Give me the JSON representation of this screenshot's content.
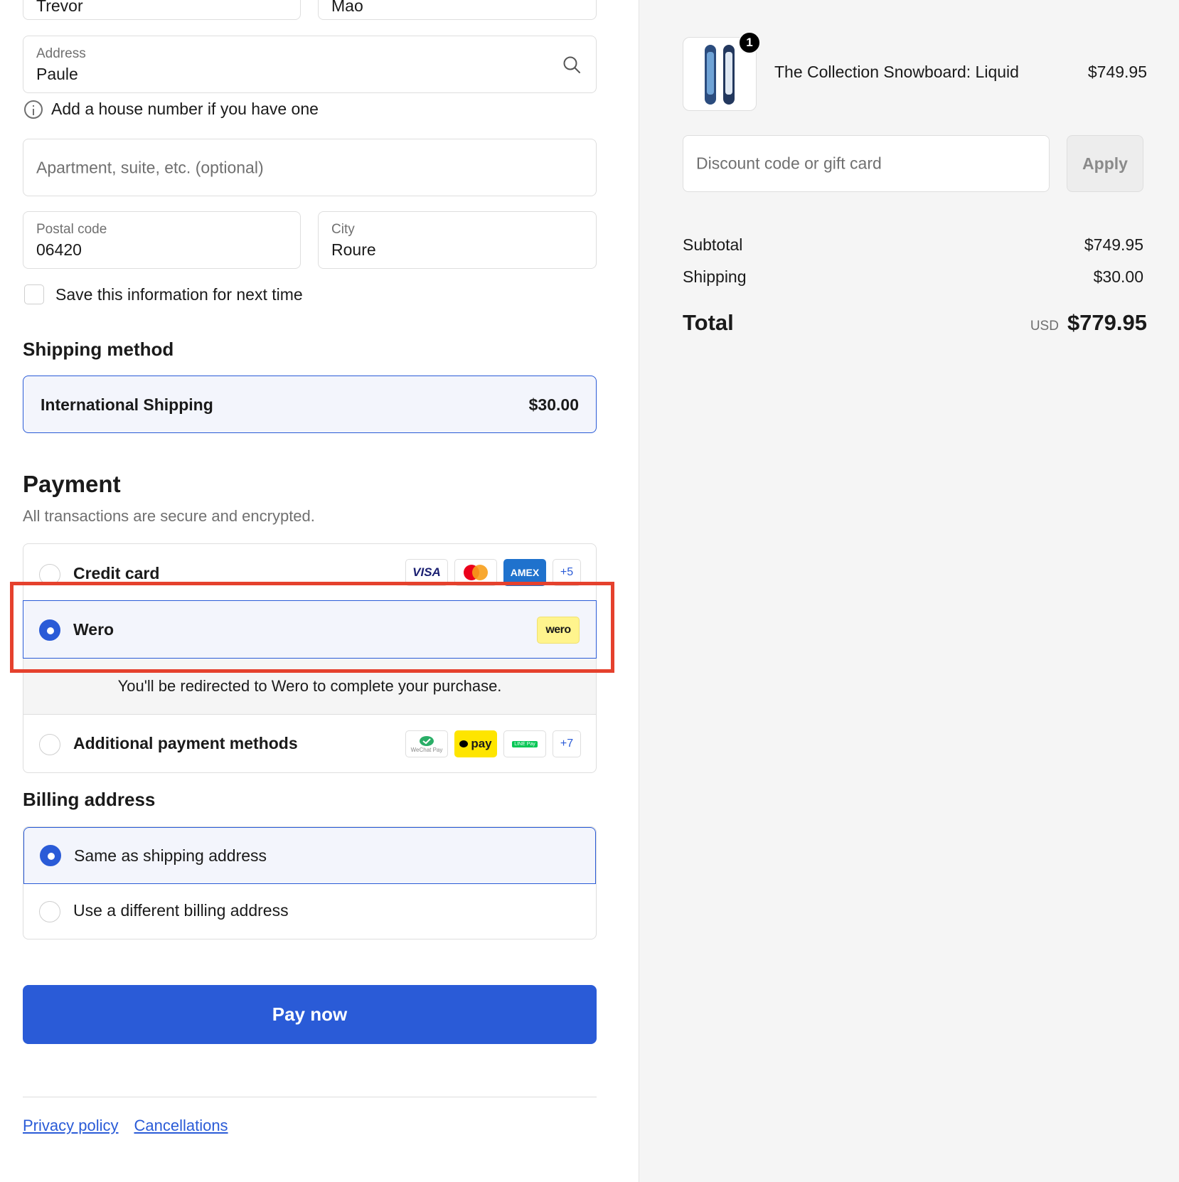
{
  "form": {
    "first_name_value": "Trevor",
    "last_name_value": "Mao",
    "address_label": "Address",
    "address_value": "Paule",
    "address_hint": "Add a house number if you have one",
    "apartment_placeholder": "Apartment, suite, etc. (optional)",
    "postal_label": "Postal code",
    "postal_value": "06420",
    "city_label": "City",
    "city_value": "Roure",
    "save_info_label": "Save this information for next time"
  },
  "shipping": {
    "heading": "Shipping method",
    "method_name": "International Shipping",
    "method_price": "$30.00"
  },
  "payment": {
    "heading": "Payment",
    "subtitle": "All transactions are secure and encrypted.",
    "credit_card_label": "Credit card",
    "card_badges": [
      "VISA",
      "mastercard",
      "AMEX",
      "+5"
    ],
    "wero_label": "Wero",
    "wero_badge": "wero",
    "redirect_text": "You'll be redirected to Wero to complete your purchase.",
    "additional_label": "Additional payment methods",
    "additional_badges": [
      "WeChat Pay",
      "pay",
      "LINE Pay",
      "+7"
    ]
  },
  "billing": {
    "heading": "Billing address",
    "same_label": "Same as shipping address",
    "different_label": "Use a different billing address"
  },
  "pay_button": "Pay now",
  "footer": {
    "privacy": "Privacy policy",
    "cancellations": "Cancellations"
  },
  "summary": {
    "product_name": "The Collection Snowboard: Liquid",
    "product_price": "$749.95",
    "quantity": "1",
    "discount_placeholder": "Discount code or gift card",
    "apply_label": "Apply",
    "subtotal_label": "Subtotal",
    "subtotal_value": "$749.95",
    "shipping_label": "Shipping",
    "shipping_value": "$30.00",
    "total_label": "Total",
    "currency": "USD",
    "total_value": "$779.95"
  },
  "colors": {
    "accent": "#2a5bd7",
    "highlight": "#e5412d",
    "panel_bg": "#f5f5f5"
  }
}
